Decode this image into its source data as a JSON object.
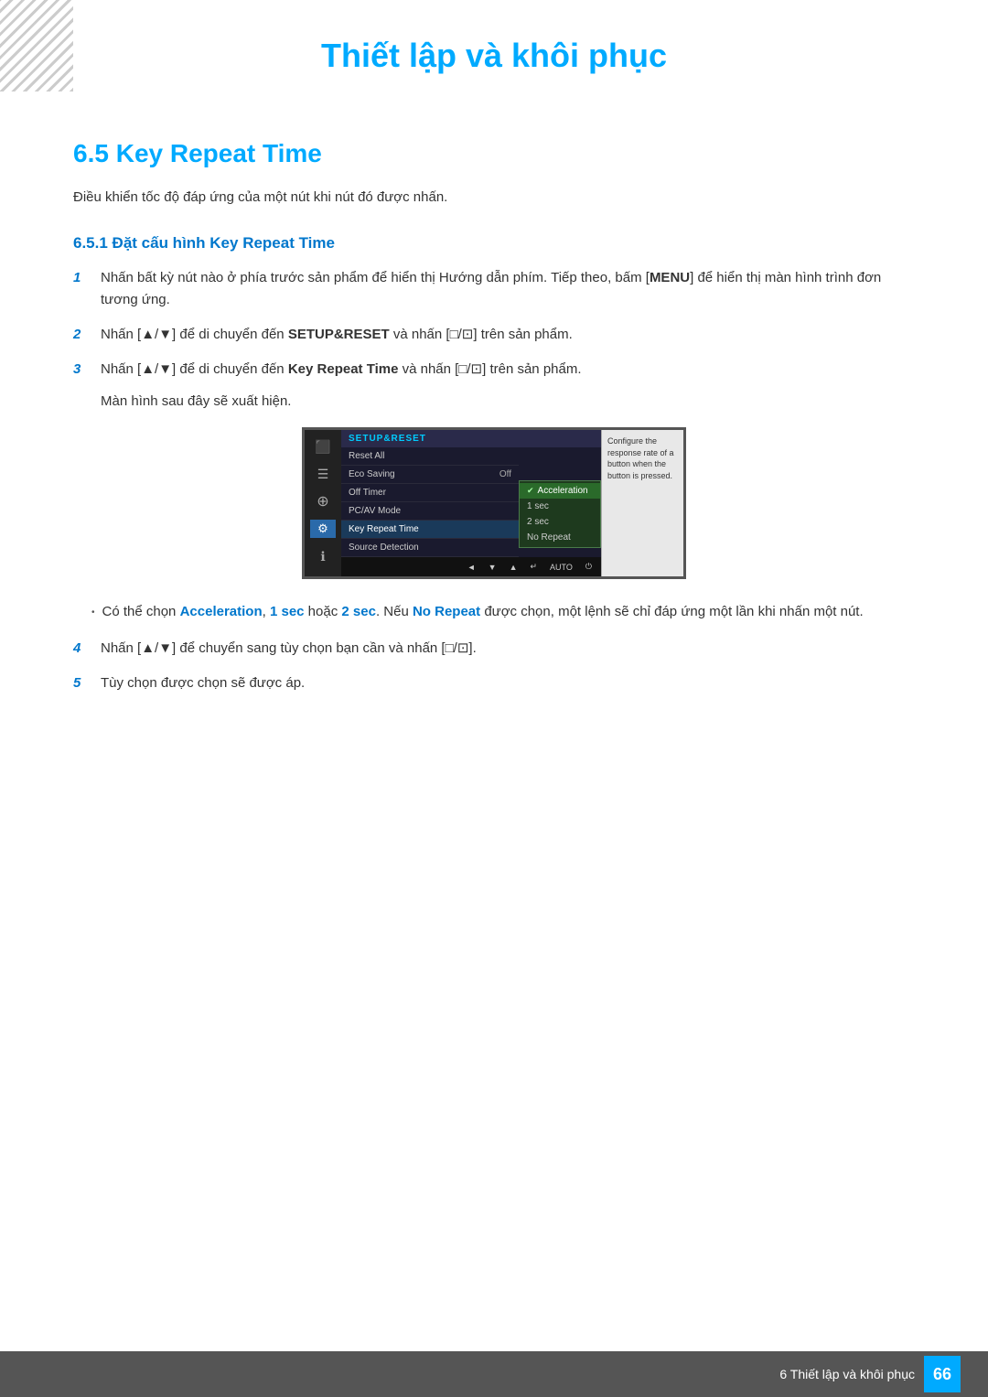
{
  "page": {
    "title": "Thiết lập và khôi phục",
    "section_number": "6.5",
    "section_title": "Key Repeat Time",
    "subsection_number": "6.5.1",
    "subsection_title": "Đặt cấu hình Key Repeat Time",
    "intro_text": "Điều khiển tốc độ đáp ứng của một nút khi nút đó được nhấn.",
    "steps": [
      {
        "number": "1",
        "text_parts": [
          "Nhấn bất kỳ nút nào ở phía trước sản phẩm để hiển thị Hướng dẫn phím. Tiếp theo, bấm [",
          "MENU",
          "] để hiển thị màn hình trình đơn tương ứng."
        ]
      },
      {
        "number": "2",
        "text_parts": [
          "Nhấn [▲/▼] để di chuyển đến ",
          "SETUP&RESET",
          " và nhấn [□/⊡] trên sản phẩm."
        ]
      },
      {
        "number": "3",
        "text_parts": [
          "Nhấn [▲/▼] để di chuyển đến ",
          "Key Repeat Time",
          " và nhấn [□/⊡] trên sản phẩm."
        ],
        "sub_text": "Màn hình sau đây sẽ xuất hiện."
      }
    ],
    "steps_4_5": [
      {
        "number": "4",
        "text": "Nhấn [▲/▼] để chuyển sang tùy chọn bạn cần và nhấn [□/⊡]."
      },
      {
        "number": "5",
        "text": "Tùy chọn được chọn sẽ được áp."
      }
    ],
    "bullet_text_parts": [
      "Có thể chọn ",
      "Acceleration",
      ", ",
      "1 sec",
      " hoặc ",
      "2 sec",
      ". Nếu ",
      "No Repeat",
      " được chọn, một lệnh sẽ chỉ đáp ứng một lần khi nhấn một nút."
    ],
    "monitor": {
      "menu_title": "SETUP&RESET",
      "items": [
        {
          "label": "Reset All",
          "value": ""
        },
        {
          "label": "Eco Saving",
          "value": "Off"
        },
        {
          "label": "Off Timer",
          "value": ""
        },
        {
          "label": "PC/AV Mode",
          "value": ""
        },
        {
          "label": "Key Repeat Time",
          "value": ""
        },
        {
          "label": "Source Detection",
          "value": ""
        }
      ],
      "submenu_items": [
        {
          "label": "Acceleration",
          "selected": true
        },
        {
          "label": "1 sec",
          "selected": false
        },
        {
          "label": "2 sec",
          "selected": false
        },
        {
          "label": "No Repeat",
          "selected": false
        }
      ],
      "tooltip": "Configure the response rate of a button when the button is pressed.",
      "bottom_buttons": [
        "◄",
        "▼",
        "▲",
        "↵",
        "AUTO",
        "⏻"
      ]
    },
    "footer": {
      "chapter_text": "6 Thiết lập và khôi phục",
      "page_number": "66"
    }
  }
}
